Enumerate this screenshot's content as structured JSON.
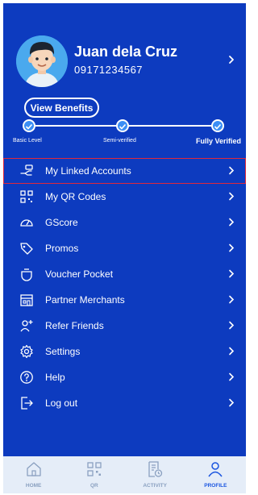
{
  "profile": {
    "name": "Juan dela Cruz",
    "phone": "09171234567",
    "benefits_label": "View Benefits"
  },
  "verification": {
    "levels": [
      "Basic Level",
      "Semi-verified",
      "Fully Verified"
    ],
    "current": "Fully Verified"
  },
  "menu": [
    {
      "label": "My Linked Accounts",
      "icon": "link-hand-icon",
      "active": true
    },
    {
      "label": "My QR Codes",
      "icon": "qr-code-icon"
    },
    {
      "label": "GScore",
      "icon": "speedometer-icon"
    },
    {
      "label": "Promos",
      "icon": "tag-icon"
    },
    {
      "label": "Voucher Pocket",
      "icon": "pocket-icon"
    },
    {
      "label": "Partner Merchants",
      "icon": "store-icon"
    },
    {
      "label": "Refer Friends",
      "icon": "add-user-icon"
    },
    {
      "label": "Settings",
      "icon": "gear-icon"
    },
    {
      "label": "Help",
      "icon": "help-icon"
    },
    {
      "label": "Log out",
      "icon": "logout-icon"
    }
  ],
  "nav": [
    {
      "label": "HOME",
      "icon": "home-icon"
    },
    {
      "label": "QR",
      "icon": "qr-icon"
    },
    {
      "label": "ACTIVITY",
      "icon": "activity-icon"
    },
    {
      "label": "PROFILE",
      "icon": "profile-icon",
      "active": true
    }
  ],
  "colors": {
    "background": "#0d3bbf",
    "accent": "#1a55e0",
    "highlight_border": "#e0283c",
    "nav_bg": "#e5edf8"
  }
}
